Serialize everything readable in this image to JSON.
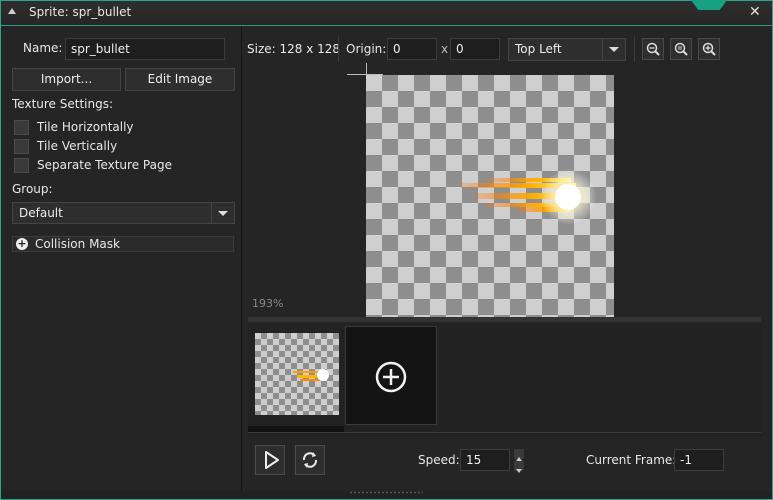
{
  "window": {
    "title": "Sprite: spr_bullet",
    "close_glyph": "✕",
    "accent": "#1fa084"
  },
  "left": {
    "name_label": "Name:",
    "name_value": "spr_bullet",
    "import_label": "Import...",
    "edit_label": "Edit Image",
    "texture_heading": "Texture Settings:",
    "checkboxes": [
      {
        "label": "Tile Horizontally",
        "checked": false
      },
      {
        "label": "Tile Vertically",
        "checked": false
      },
      {
        "label": "Separate Texture Page",
        "checked": false
      }
    ],
    "group_label": "Group:",
    "group_value": "Default",
    "collision_label": "Collision Mask",
    "collision_icon": "plus-circle-icon"
  },
  "toolbar": {
    "size_label": "Size: 128 x 128",
    "origin_label": "Origin:",
    "origin_x": "0",
    "x_sep": "x",
    "origin_y": "0",
    "origin_preset": "Top Left",
    "zoom_out_icon": "zoom-out-icon",
    "zoom_reset_icon": "zoom-reset-icon",
    "zoom_in_icon": "zoom-in-icon"
  },
  "canvas": {
    "zoom_text": "193%"
  },
  "playback": {
    "play_icon": "play-icon",
    "loop_icon": "loop-icon",
    "speed_label": "Speed:",
    "speed_value": "15",
    "frame_label": "Current Frame:",
    "frame_value": "-1"
  }
}
